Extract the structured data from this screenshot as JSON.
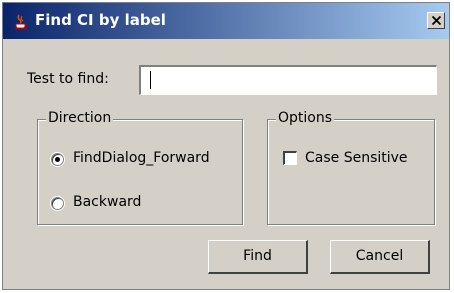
{
  "window": {
    "title": "Find CI by label",
    "icon": "java-cup-icon",
    "close_icon": "close-icon"
  },
  "search": {
    "label": "Test to find:",
    "value": "",
    "placeholder": ""
  },
  "direction": {
    "legend": "Direction",
    "options": [
      {
        "label": "FindDialog_Forward",
        "selected": true
      },
      {
        "label": "Backward",
        "selected": false
      }
    ]
  },
  "options": {
    "legend": "Options",
    "case_sensitive_label": "Case Sensitive",
    "case_sensitive_checked": false
  },
  "buttons": {
    "find": "Find",
    "cancel": "Cancel"
  },
  "colors": {
    "dialog_bg": "#d4d0c8",
    "title_start": "#0a246a",
    "title_end": "#a6caf0"
  }
}
